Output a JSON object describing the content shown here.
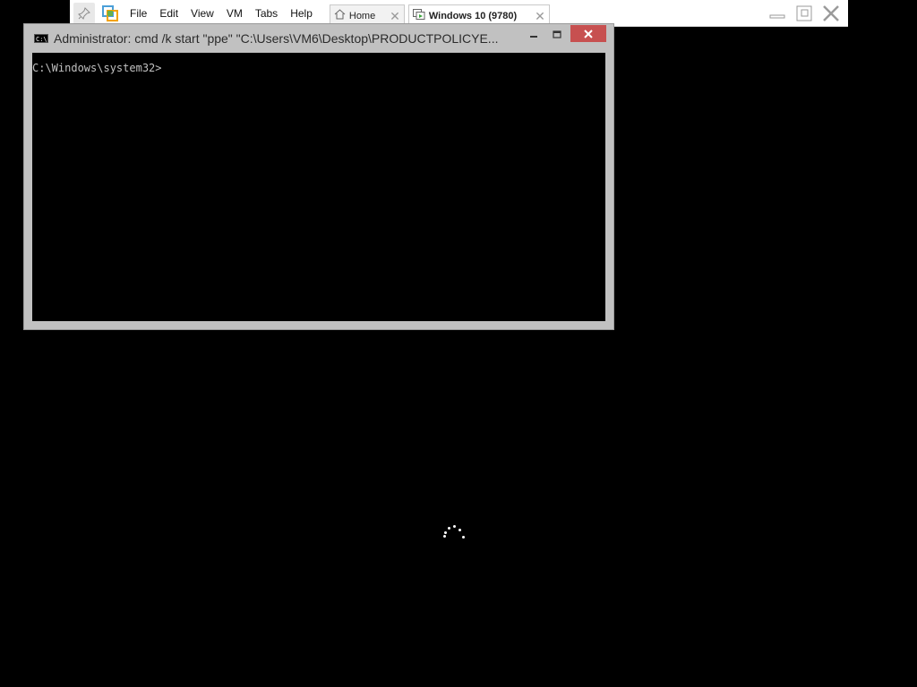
{
  "vmware": {
    "menu": [
      "File",
      "Edit",
      "View",
      "VM",
      "Tabs",
      "Help"
    ],
    "tabs": [
      {
        "label": "Home",
        "icon": "home-icon",
        "active": false
      },
      {
        "label": "Windows 10 (9780)",
        "icon": "vm-icon",
        "active": true
      }
    ],
    "icons": {
      "pin": "pin-icon",
      "logo": "vmware-logo-icon",
      "minimize": "minimize-icon",
      "restore": "restore-icon",
      "close": "close-icon"
    }
  },
  "console_window": {
    "title": "Administrator: cmd /k start \"ppe\" \"C:\\Users\\VM6\\Desktop\\PRODUCTPOLICYE...",
    "prompt": "C:\\Windows\\system32>",
    "close_color": "#c75050",
    "icons": {
      "app": "command-prompt-icon",
      "minimize": "minimize-icon",
      "maximize": "maximize-icon",
      "close": "close-icon"
    }
  },
  "desktop": {
    "background": "#000000",
    "spinner": "loading-spinner-icon"
  }
}
